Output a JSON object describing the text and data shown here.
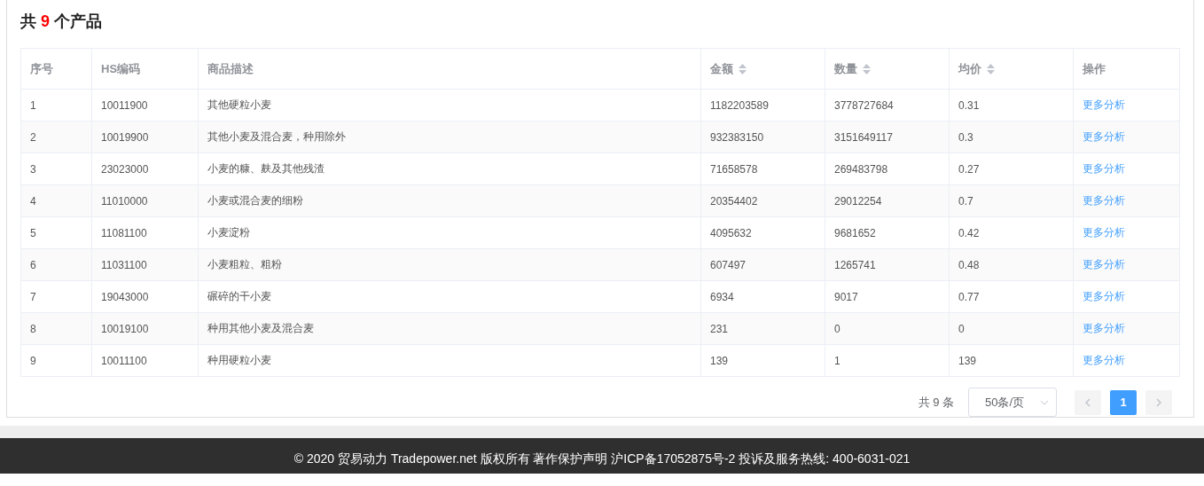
{
  "header": {
    "prefix": "共",
    "count": "9",
    "suffix": "个产品"
  },
  "table": {
    "columns": [
      {
        "label": "序号",
        "sortable": false
      },
      {
        "label": "HS编码",
        "sortable": false
      },
      {
        "label": "商品描述",
        "sortable": false
      },
      {
        "label": "金额",
        "sortable": true
      },
      {
        "label": "数量",
        "sortable": true
      },
      {
        "label": "均价",
        "sortable": true
      },
      {
        "label": "操作",
        "sortable": false
      }
    ],
    "rows": [
      {
        "cells": [
          "1",
          "10011900",
          "其他硬粒小麦",
          "1182203589",
          "3778727684",
          "0.31"
        ],
        "action": "更多分析"
      },
      {
        "cells": [
          "2",
          "10019900",
          "其他小麦及混合麦，种用除外",
          "932383150",
          "3151649117",
          "0.3"
        ],
        "action": "更多分析"
      },
      {
        "cells": [
          "3",
          "23023000",
          "小麦的糠、麸及其他残渣",
          "71658578",
          "269483798",
          "0.27"
        ],
        "action": "更多分析"
      },
      {
        "cells": [
          "4",
          "11010000",
          "小麦或混合麦的细粉",
          "20354402",
          "29012254",
          "0.7"
        ],
        "action": "更多分析"
      },
      {
        "cells": [
          "5",
          "11081100",
          "小麦淀粉",
          "4095632",
          "9681652",
          "0.42"
        ],
        "action": "更多分析"
      },
      {
        "cells": [
          "6",
          "11031100",
          "小麦粗粒、粗粉",
          "607497",
          "1265741",
          "0.48"
        ],
        "action": "更多分析"
      },
      {
        "cells": [
          "7",
          "19043000",
          "碾碎的干小麦",
          "6934",
          "9017",
          "0.77"
        ],
        "action": "更多分析"
      },
      {
        "cells": [
          "8",
          "10019100",
          "种用其他小麦及混合麦",
          "231",
          "0",
          "0"
        ],
        "action": "更多分析"
      },
      {
        "cells": [
          "9",
          "10011100",
          "种用硬粒小麦",
          "139",
          "1",
          "139"
        ],
        "action": "更多分析"
      }
    ]
  },
  "pagination": {
    "total": "共 9 条",
    "page_size": "50条/页",
    "pages": [
      {
        "label": "1",
        "selected": true
      }
    ]
  },
  "footer": "© 2020 贸易动力 Tradepower.net 版权所有 著作保护声明 沪ICP备17052875号-2 投诉及服务热线: 400-6031-021"
}
